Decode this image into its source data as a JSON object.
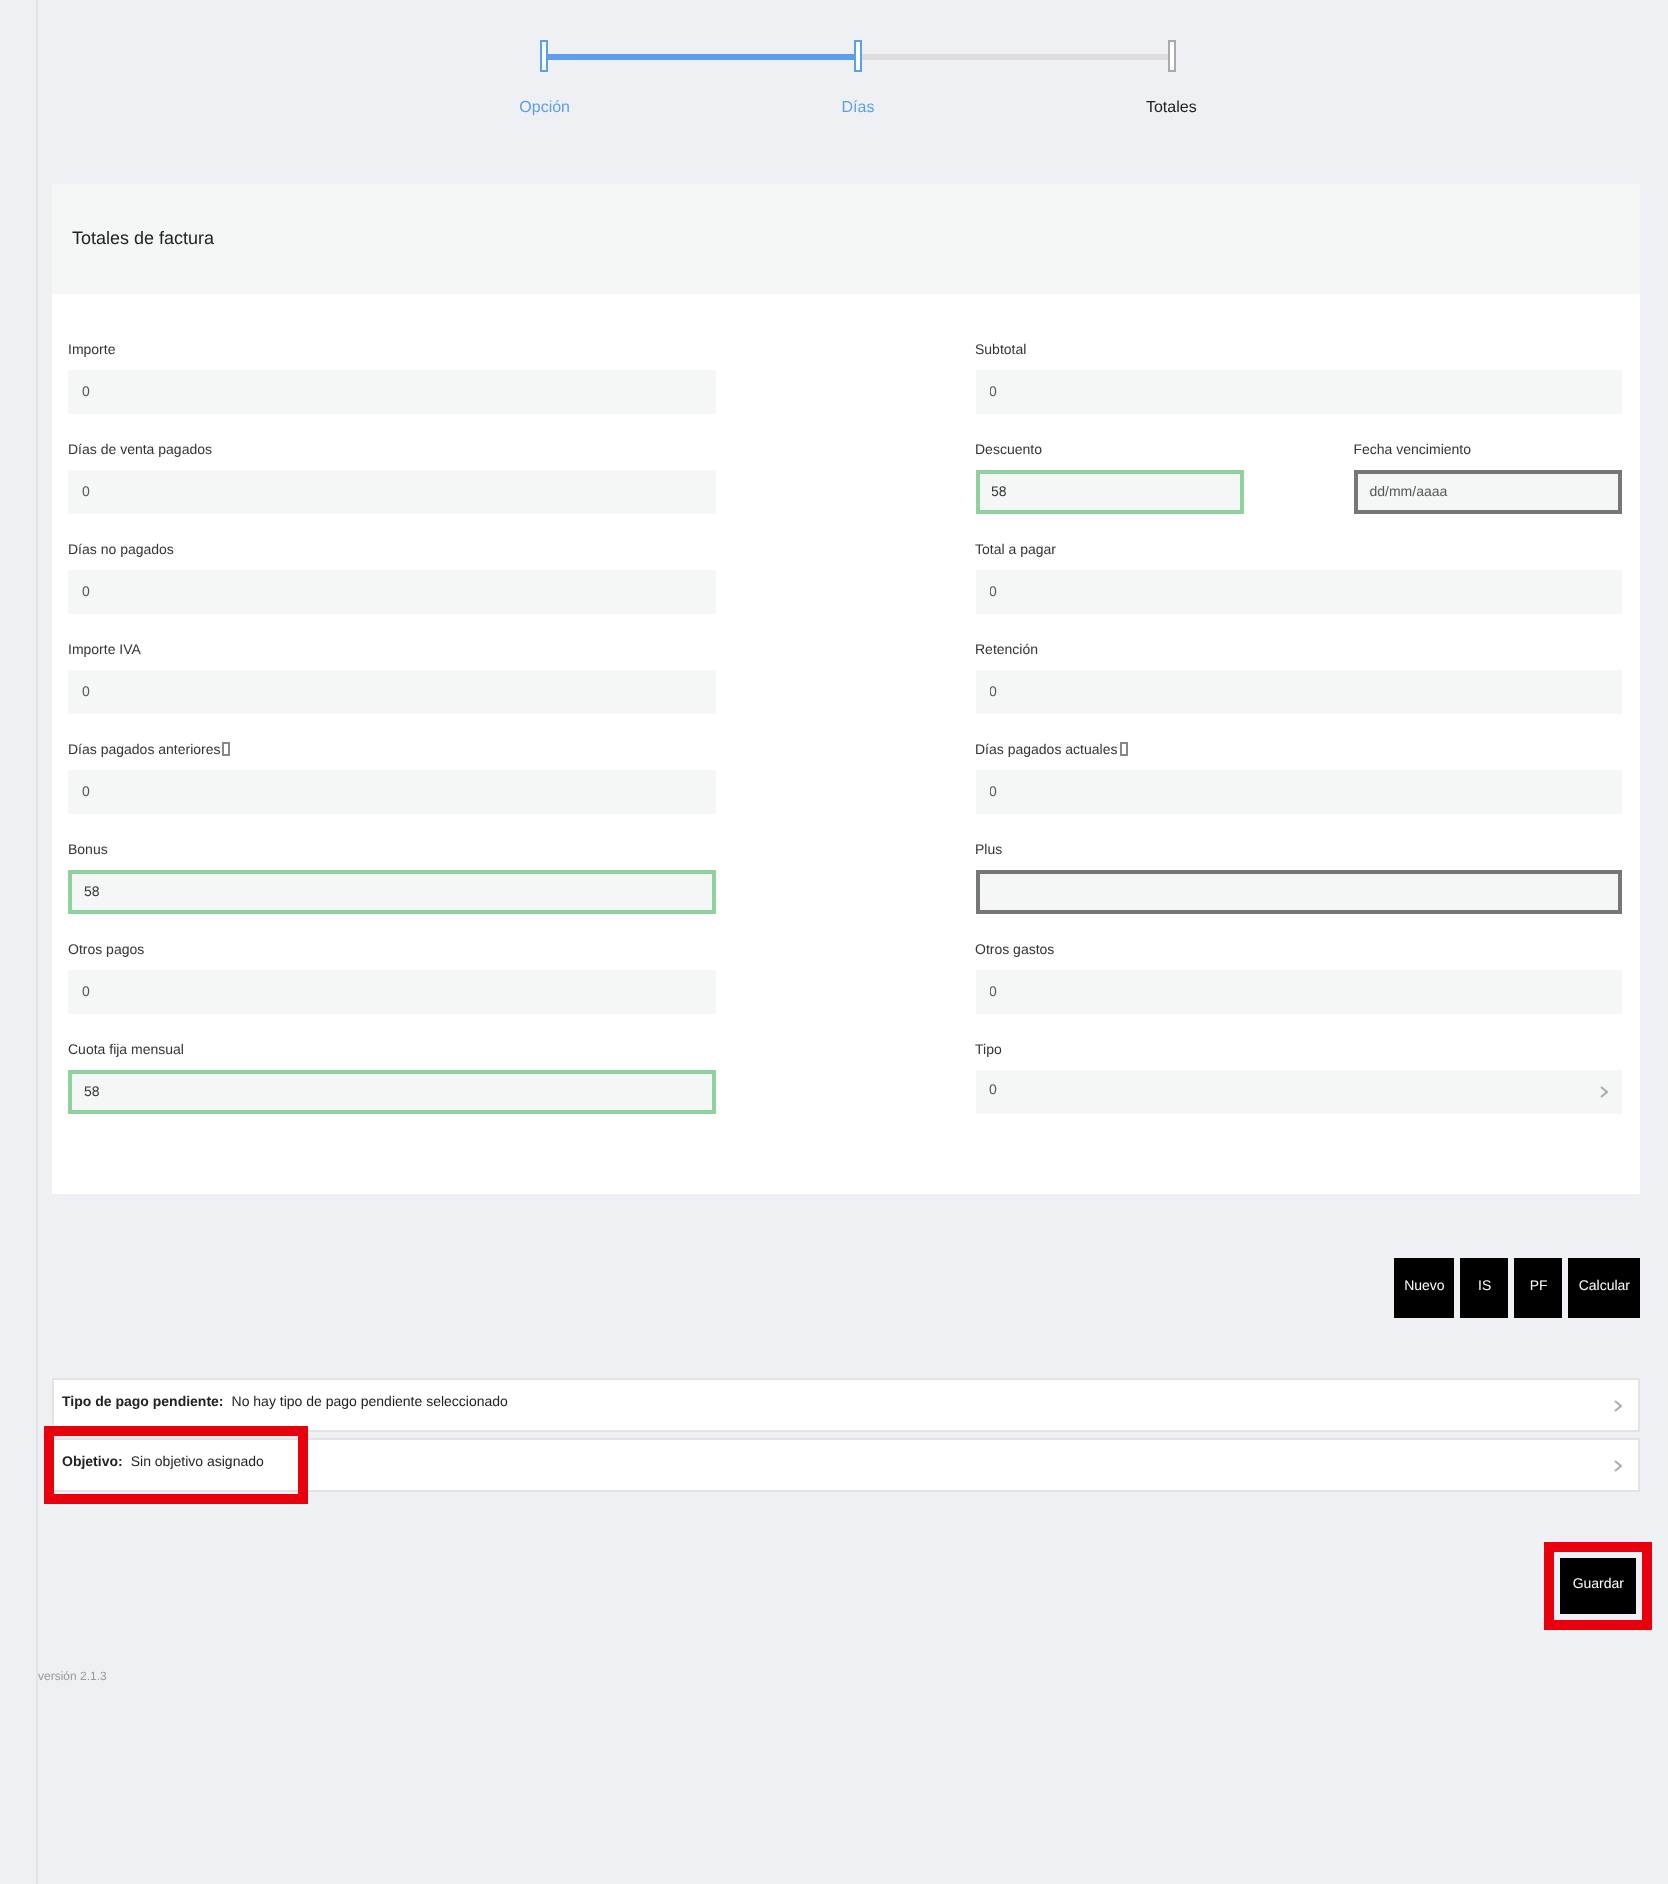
{
  "stepper": {
    "steps": [
      {
        "label": "Opción",
        "done": true
      },
      {
        "label": "Días",
        "done": true
      },
      {
        "label": "Totales",
        "done": false
      }
    ]
  },
  "card": {
    "title": "Totales de factura",
    "fields": [
      {
        "label": "Importe",
        "value": "0",
        "kind": "readonly",
        "info": false
      },
      {
        "label": "Subtotal",
        "value": "0",
        "kind": "readonly",
        "info": false
      },
      {
        "label": "Días de venta pagados",
        "value": "0",
        "kind": "readonly",
        "info": false
      },
      {
        "label": "Descuento",
        "value": "58",
        "kind": "valid",
        "info": false
      },
      {
        "label": "Fecha vencimiento",
        "value": "dd/mm/aaaa",
        "kind": "outlined",
        "info": false
      },
      {
        "label": "Días no pagados",
        "value": "0",
        "kind": "readonly",
        "info": false
      },
      {
        "label": "Total a pagar",
        "value": "0",
        "kind": "readonly",
        "info": false
      },
      {
        "label": "Importe IVA",
        "value": "0",
        "kind": "readonly",
        "info": false
      },
      {
        "label": "Retención",
        "value": "0",
        "kind": "readonly",
        "info": false
      },
      {
        "label": "Días pagados anteriores",
        "value": "0",
        "kind": "readonly",
        "info": true
      },
      {
        "label": "Días pagados actuales",
        "value": "0",
        "kind": "readonly",
        "info": true
      },
      {
        "label": "Bonus",
        "value": "58",
        "kind": "valid",
        "info": false
      },
      {
        "label": "Plus",
        "kind": "outlined",
        "info": false
      },
      {
        "label": "Otros pagos",
        "value": "0",
        "kind": "readonly",
        "info": false
      },
      {
        "label": "Otros gastos",
        "value": "0",
        "kind": "readonly",
        "info": false
      },
      {
        "label": "Cuota fija mensual",
        "value": "58",
        "kind": "valid",
        "info": false
      },
      {
        "label": "Tipo",
        "value": "0",
        "kind": "select",
        "info": false
      }
    ]
  },
  "actions": [
    "Nuevo",
    "IS",
    "PF",
    "Calcular"
  ],
  "accordion": [
    {
      "label": "Tipo de pago pendiente:",
      "value": "No hay tipo de pago pendiente seleccionado",
      "highlighted": false
    },
    {
      "label": "Objetivo:",
      "value": "Sin objetivo asignado",
      "highlighted": true
    }
  ],
  "save": {
    "label": "Guardar",
    "highlighted": true
  },
  "footer": "versión 2.1.3"
}
